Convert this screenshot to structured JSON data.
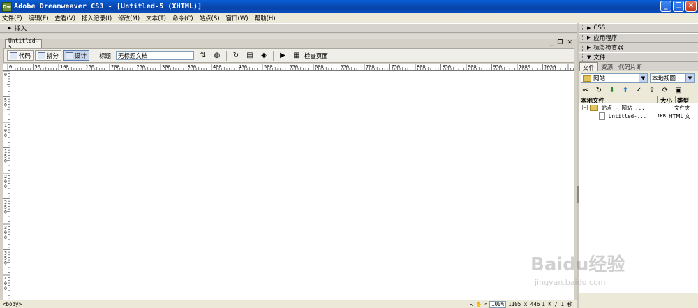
{
  "window": {
    "title": "Adobe Dreamweaver CS3 - [Untitled-5 (XHTML)]",
    "app_icon_text": "Dw",
    "buttons": [
      "_",
      "❐",
      "✕"
    ]
  },
  "menu": [
    "文件(F)",
    "编辑(E)",
    "查看(V)",
    "插入记录(I)",
    "修改(M)",
    "文本(T)",
    "命令(C)",
    "站点(S)",
    "窗口(W)",
    "帮助(H)"
  ],
  "insert_bar": {
    "label": "插入"
  },
  "document": {
    "tab_label": "Untitled-5",
    "view_buttons": [
      "代码",
      "拆分",
      "设计"
    ],
    "title_label": "标题:",
    "title_value": "无标题文档",
    "check_page_label": "检查页面",
    "ruler_ticks": [
      "0",
      "50",
      "100",
      "150",
      "200",
      "250",
      "300",
      "350",
      "400",
      "450",
      "500",
      "550",
      "600",
      "650",
      "700",
      "750",
      "800",
      "850",
      "900",
      "950",
      "1000",
      "1050"
    ],
    "vruler_ticks": [
      "0",
      "50",
      "100",
      "150",
      "200",
      "250",
      "300",
      "350",
      "400"
    ]
  },
  "status": {
    "tag": "<body>",
    "zoom": "100%",
    "dimensions": "1105 x 446",
    "size": "1 K / 1 秒"
  },
  "panels": {
    "css": "CSS",
    "app": "应用程序",
    "tag_inspector": "标签检查器",
    "files": "文件",
    "tabs": [
      "文件",
      "资源",
      "代码片断"
    ],
    "site_select": "网站",
    "view_select": "本地视图",
    "columns": {
      "name": "本地文件",
      "size": "大小",
      "type": "类型"
    },
    "rows": [
      {
        "name": "站点 - 网站 ...",
        "size": "",
        "type": "文件夹"
      },
      {
        "name": "Untitled-...",
        "size": "1KB",
        "type": "HTML 文"
      }
    ]
  },
  "watermark": {
    "text": "Baidu经验",
    "sub": "jingyan.baidu.com"
  },
  "colors": {
    "titlebar": "#0a5fd8",
    "panel": "#ece9d8",
    "canvas": "#ffffff"
  }
}
